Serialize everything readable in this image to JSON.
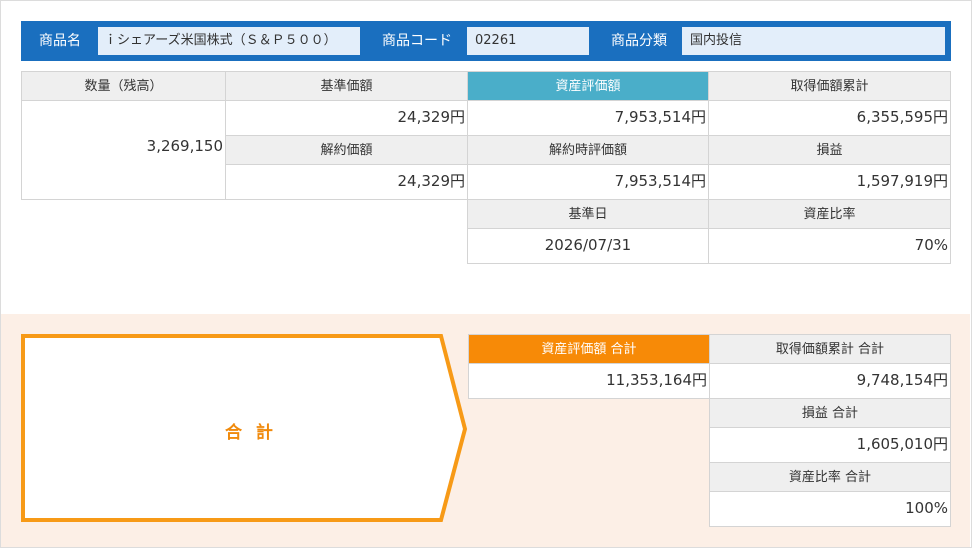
{
  "header": {
    "product_name_label": "商品名",
    "product_name_value": "ｉシェアーズ米国株式（Ｓ＆Ｐ５００）",
    "product_code_label": "商品コード",
    "product_code_value": "02261",
    "product_category_label": "商品分類",
    "product_category_value": "国内投信"
  },
  "detail": {
    "quantity_header": "数量（残高）",
    "quantity_value": "3,269,150",
    "base_price_header": "基準価額",
    "base_price_value": "24,329円",
    "cancel_price_header": "解約価額",
    "cancel_price_value": "24,329円",
    "asset_value_header": "資産評価額",
    "asset_value_value": "7,953,514円",
    "cancel_eval_header": "解約時評価額",
    "cancel_eval_value": "7,953,514円",
    "base_date_header": "基準日",
    "base_date_value": "2026/07/31",
    "acquisition_header": "取得価額累計",
    "acquisition_value": "6,355,595円",
    "pnl_header": "損益",
    "pnl_value": "1,597,919円",
    "ratio_header": "資産比率",
    "ratio_value": "70%"
  },
  "total": {
    "label": "合 計",
    "asset_total_header": "資産評価額 合計",
    "asset_total_value": "11,353,164円",
    "acquisition_total_header": "取得価額累計 合計",
    "acquisition_total_value": "9,748,154円",
    "pnl_total_header": "損益 合計",
    "pnl_total_value": "1,605,010円",
    "ratio_total_header": "資産比率 合計",
    "ratio_total_value": "100%"
  },
  "colors": {
    "header_bar": "#1a6fbf",
    "asset_header": "#4aaec9",
    "total_header": "#f78a07",
    "total_accent": "#f08a0c",
    "total_band": "#fcefe6"
  }
}
